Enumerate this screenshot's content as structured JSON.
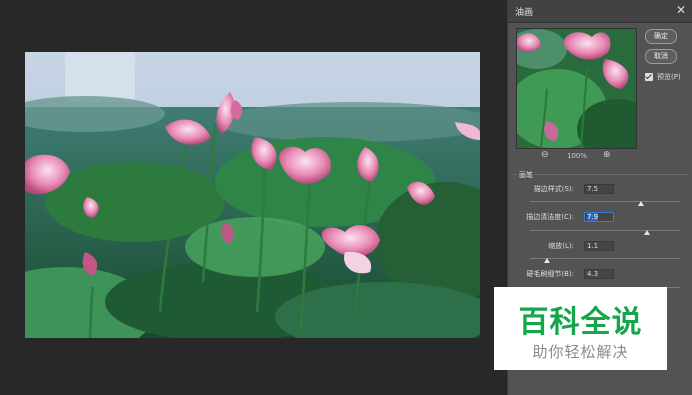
{
  "dialog": {
    "title": "油画",
    "close_glyph": "✕",
    "ok_label": "确定",
    "cancel_label": "取消",
    "preview_label": "预览(P)",
    "preview_checked": true,
    "zoom_out_glyph": "⊖",
    "zoom_in_glyph": "⊕",
    "zoom_level": "100%",
    "group_title": "画笔",
    "params": [
      {
        "label": "描边样式(S):",
        "value": "7.5",
        "slider_fraction": 0.74
      },
      {
        "label": "描边清洁度(C):",
        "value": "7.9",
        "slider_fraction": 0.78
      },
      {
        "label": "缩放(L):",
        "value": "1.1",
        "slider_fraction": 0.11
      },
      {
        "label": "硬毛刷细节(B):",
        "value": "4.3",
        "slider_fraction": 0.43
      }
    ]
  },
  "watermark": {
    "title": "百科全说",
    "subtitle": "助你轻松解决",
    "color": "#14a74a"
  }
}
